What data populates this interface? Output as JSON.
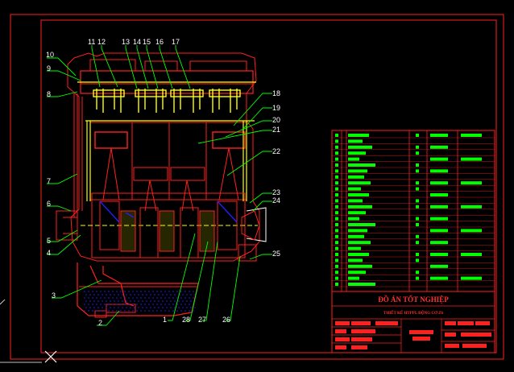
{
  "drawing": {
    "title_block": {
      "title": "ĐỒ ÁN TỐT NGHIỆP",
      "subtitle": "THIẾT KẾ HTPPL ĐỘNG CƠ Z6"
    },
    "callouts": [
      "1",
      "2",
      "3",
      "4",
      "5",
      "6",
      "7",
      "8",
      "9",
      "10",
      "11",
      "12",
      "13",
      "14",
      "15",
      "16",
      "17",
      "18",
      "19",
      "20",
      "21",
      "22",
      "23",
      "24",
      "25",
      "26",
      "27",
      "28"
    ],
    "colors": {
      "background": "#000000",
      "frame": "#ff2020",
      "geometry": "#ff2020",
      "leaders": "#00ff00",
      "highlights": "#ffff00",
      "oil": "#2020ff"
    },
    "icons": [
      "ucs-crosshair-icon"
    ]
  }
}
